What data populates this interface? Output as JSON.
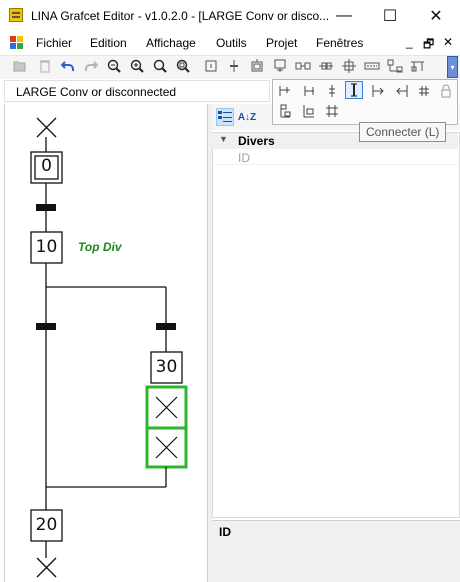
{
  "window": {
    "title": "LINA Grafcet Editor - v1.0.2.0 - [LARGE Conv or disco...",
    "controls": {
      "minimize": "—",
      "maximize": "☐",
      "close": "✕"
    }
  },
  "menu": {
    "items": [
      "Fichier",
      "Edition",
      "Affichage",
      "Outils",
      "Projet",
      "Fenêtres"
    ],
    "mdi_controls": {
      "minimize": "_",
      "restore": "🗗",
      "close": "✕"
    }
  },
  "toolbar": {
    "icons": [
      "open-folder-icon",
      "delete-icon",
      "undo-icon",
      "redo-icon",
      "zoom-out-icon",
      "zoom-in-icon",
      "zoom-minus-icon",
      "zoom-fit-icon",
      "step-icon",
      "transition-icon",
      "initial-step-icon",
      "macro-step-icon",
      "link-icon",
      "divergence-or-icon",
      "divergence-and-icon",
      "comment-icon",
      "jump-icon",
      "align-icon"
    ],
    "overflow_glyph": "▾"
  },
  "document_tab": {
    "label": "LARGE Conv or disconnected"
  },
  "overflow_panel": {
    "icons": [
      "insert-step-icon",
      "insert-transition-icon",
      "split-icon",
      "connect-icon",
      "link-forward-icon",
      "link-back-icon",
      "grid-icon",
      "lock-icon",
      "insert-below-icon",
      "insert-parallel-icon",
      "insert-multiple-icon"
    ],
    "active_index": 3,
    "tooltip": "Connecter (L)"
  },
  "property_panel": {
    "category": "Divers",
    "rows": [
      {
        "label": "ID",
        "value": ""
      }
    ],
    "description_title": "ID",
    "sort_buttons": [
      "categorized-sort-icon",
      "alphabetical-sort-icon"
    ],
    "sort_alpha_glyph": "A↓Z"
  },
  "grafcet": {
    "steps": [
      {
        "number": "0",
        "initial": true
      },
      {
        "number": "10",
        "comment": "Top Div"
      },
      {
        "number": "30"
      },
      {
        "number": "20"
      }
    ],
    "empty_steps_count": 2,
    "colors": {
      "selection": "#2db52d",
      "comment": "#1e8a1e"
    }
  }
}
